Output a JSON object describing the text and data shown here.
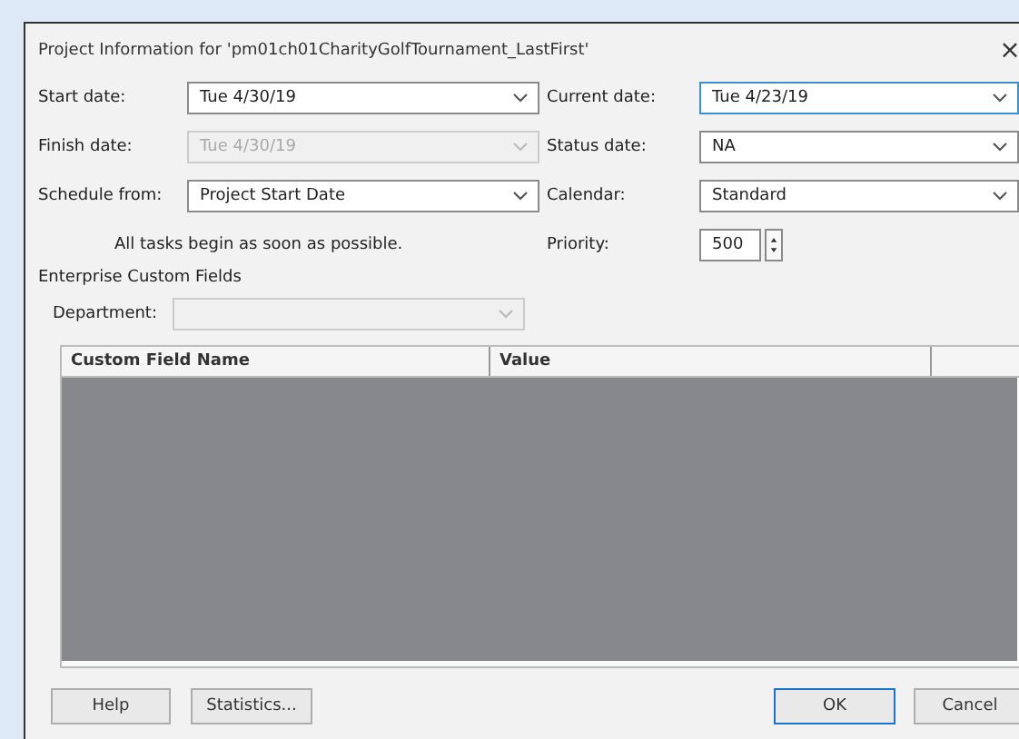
{
  "window": {
    "title": "Project Information for 'pm01ch01CharityGolfTournament_LastFirst'",
    "close": "×"
  },
  "left_fields": [
    {
      "label": "Start date:",
      "value": "Tue 4/30/19",
      "disabled": false
    },
    {
      "label": "Finish date:",
      "value": "Tue 4/30/19",
      "disabled": true
    },
    {
      "label": "Schedule from:",
      "value": "Project Start Date",
      "disabled": false
    }
  ],
  "right_fields": [
    {
      "label": "Current date:",
      "value": "Tue 4/23/19",
      "focused": true
    },
    {
      "label": "Status date:",
      "value": "NA",
      "focused": false
    },
    {
      "label": "Calendar:",
      "value": "Standard",
      "focused": false
    }
  ],
  "schedule_note": "All tasks begin as soon as possible.",
  "priority": {
    "label": "Priority:",
    "value": "500"
  },
  "enterprise": {
    "title": "Enterprise Custom Fields",
    "department": {
      "label": "Department:",
      "disabled": true
    },
    "table": {
      "columns": [
        "Custom Field Name",
        "Value"
      ]
    }
  },
  "buttons": [
    {
      "label": "Help",
      "default": false
    },
    {
      "label": "Statistics...",
      "default": false
    },
    {
      "label": "OK",
      "default": true
    },
    {
      "label": "Cancel",
      "default": false
    }
  ]
}
